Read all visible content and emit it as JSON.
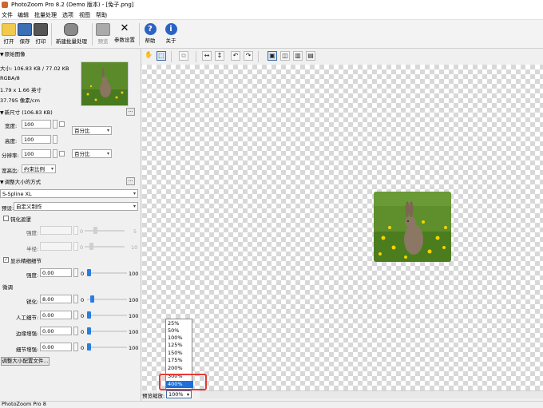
{
  "window": {
    "title": "PhotoZoom Pro 8.2 (Demo 版本) - [兔子.png]"
  },
  "menu": [
    "文件",
    "编辑",
    "批量处理",
    "选项",
    "视图",
    "帮助"
  ],
  "toolbar": {
    "open": "打开",
    "save": "保存",
    "print": "打印",
    "batch": "新建批量处理",
    "preview": "预览",
    "settings": "参数设置",
    "help": "帮助",
    "about": "关于"
  },
  "original": {
    "header": "原始图像",
    "size": "大小: 106.83 KB / 77.02 KB",
    "mode": "RGBA/8",
    "dims": "1.79 x 1.66 英寸",
    "res": "37.795 像素/cm"
  },
  "newsize": {
    "header": "新尺寸 (106.83 KB)",
    "width_label": "宽度:",
    "width_value": "100",
    "height_label": "高度:",
    "height_value": "100",
    "res_label": "分辨率:",
    "res_value": "100",
    "unit1": "百分比",
    "unit2": "百分比",
    "aspect_label": "宽高比:",
    "aspect_value": "约束比例"
  },
  "resize": {
    "header": "调整大小的方式",
    "method": "S-Spline XL",
    "preset_label": "预设:",
    "preset_value": "自定义制作",
    "unsharp_label": "钝化遮罩",
    "strength_label": "强度:",
    "strength_value": "0.00",
    "strength_min": "0",
    "strength_max": "5",
    "radius_label": "半径:",
    "radius_value": "1.00",
    "radius_min": "0",
    "radius_max": "10",
    "show_detail_label": "显示精细细节",
    "detail_strength_label": "强度:",
    "detail_strength_value": "0.00",
    "detail_min": "0",
    "detail_max": "100",
    "finetune_label": "微调",
    "sharp_label": "锐化:",
    "sharp_value": "8.00",
    "artifact_label": "人工细节:",
    "artifact_value": "0.00",
    "edge_label": "边缘增强:",
    "edge_value": "0.00",
    "grain_label": "细节增强:",
    "grain_value": "0.00",
    "slider_min": "0",
    "slider_max": "100",
    "presets_button": "调整大小配置文件..."
  },
  "zoom": {
    "label": "预览缩放:",
    "value": "100%",
    "options": [
      "25%",
      "50%",
      "100%",
      "125%",
      "150%",
      "175%",
      "200%",
      "300%",
      "400%"
    ],
    "selected_index": 8
  },
  "status": "PhotoZoom Pro 8"
}
